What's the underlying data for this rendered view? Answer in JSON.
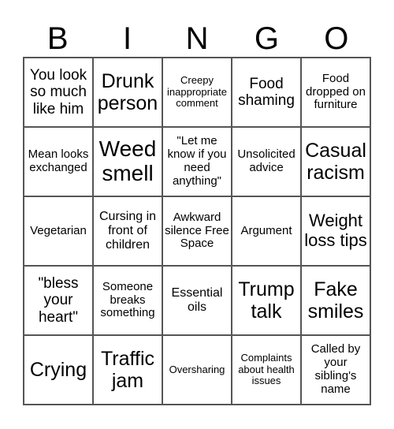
{
  "header": {
    "letters": [
      "B",
      "I",
      "N",
      "G",
      "O"
    ]
  },
  "cells": [
    "You look so much like him",
    "Drunk person",
    "Creepy inappropriate comment",
    "Food shaming",
    "Food dropped on furniture",
    "Mean looks exchanged",
    "Weed smell",
    "\"Let me know if you need anything\"",
    "Unsolicited advice",
    "Casual racism",
    "Vegetarian",
    "Cursing in front of children",
    "Awkward silence Free Space",
    "Argument",
    "Weight loss tips",
    "\"bless your heart\"",
    "Someone breaks something",
    "Essential oils",
    "Trump talk",
    "Fake smiles",
    "Crying",
    "Traffic jam",
    "Oversharing",
    "Complaints about health issues",
    "Called by your sibling's name"
  ]
}
